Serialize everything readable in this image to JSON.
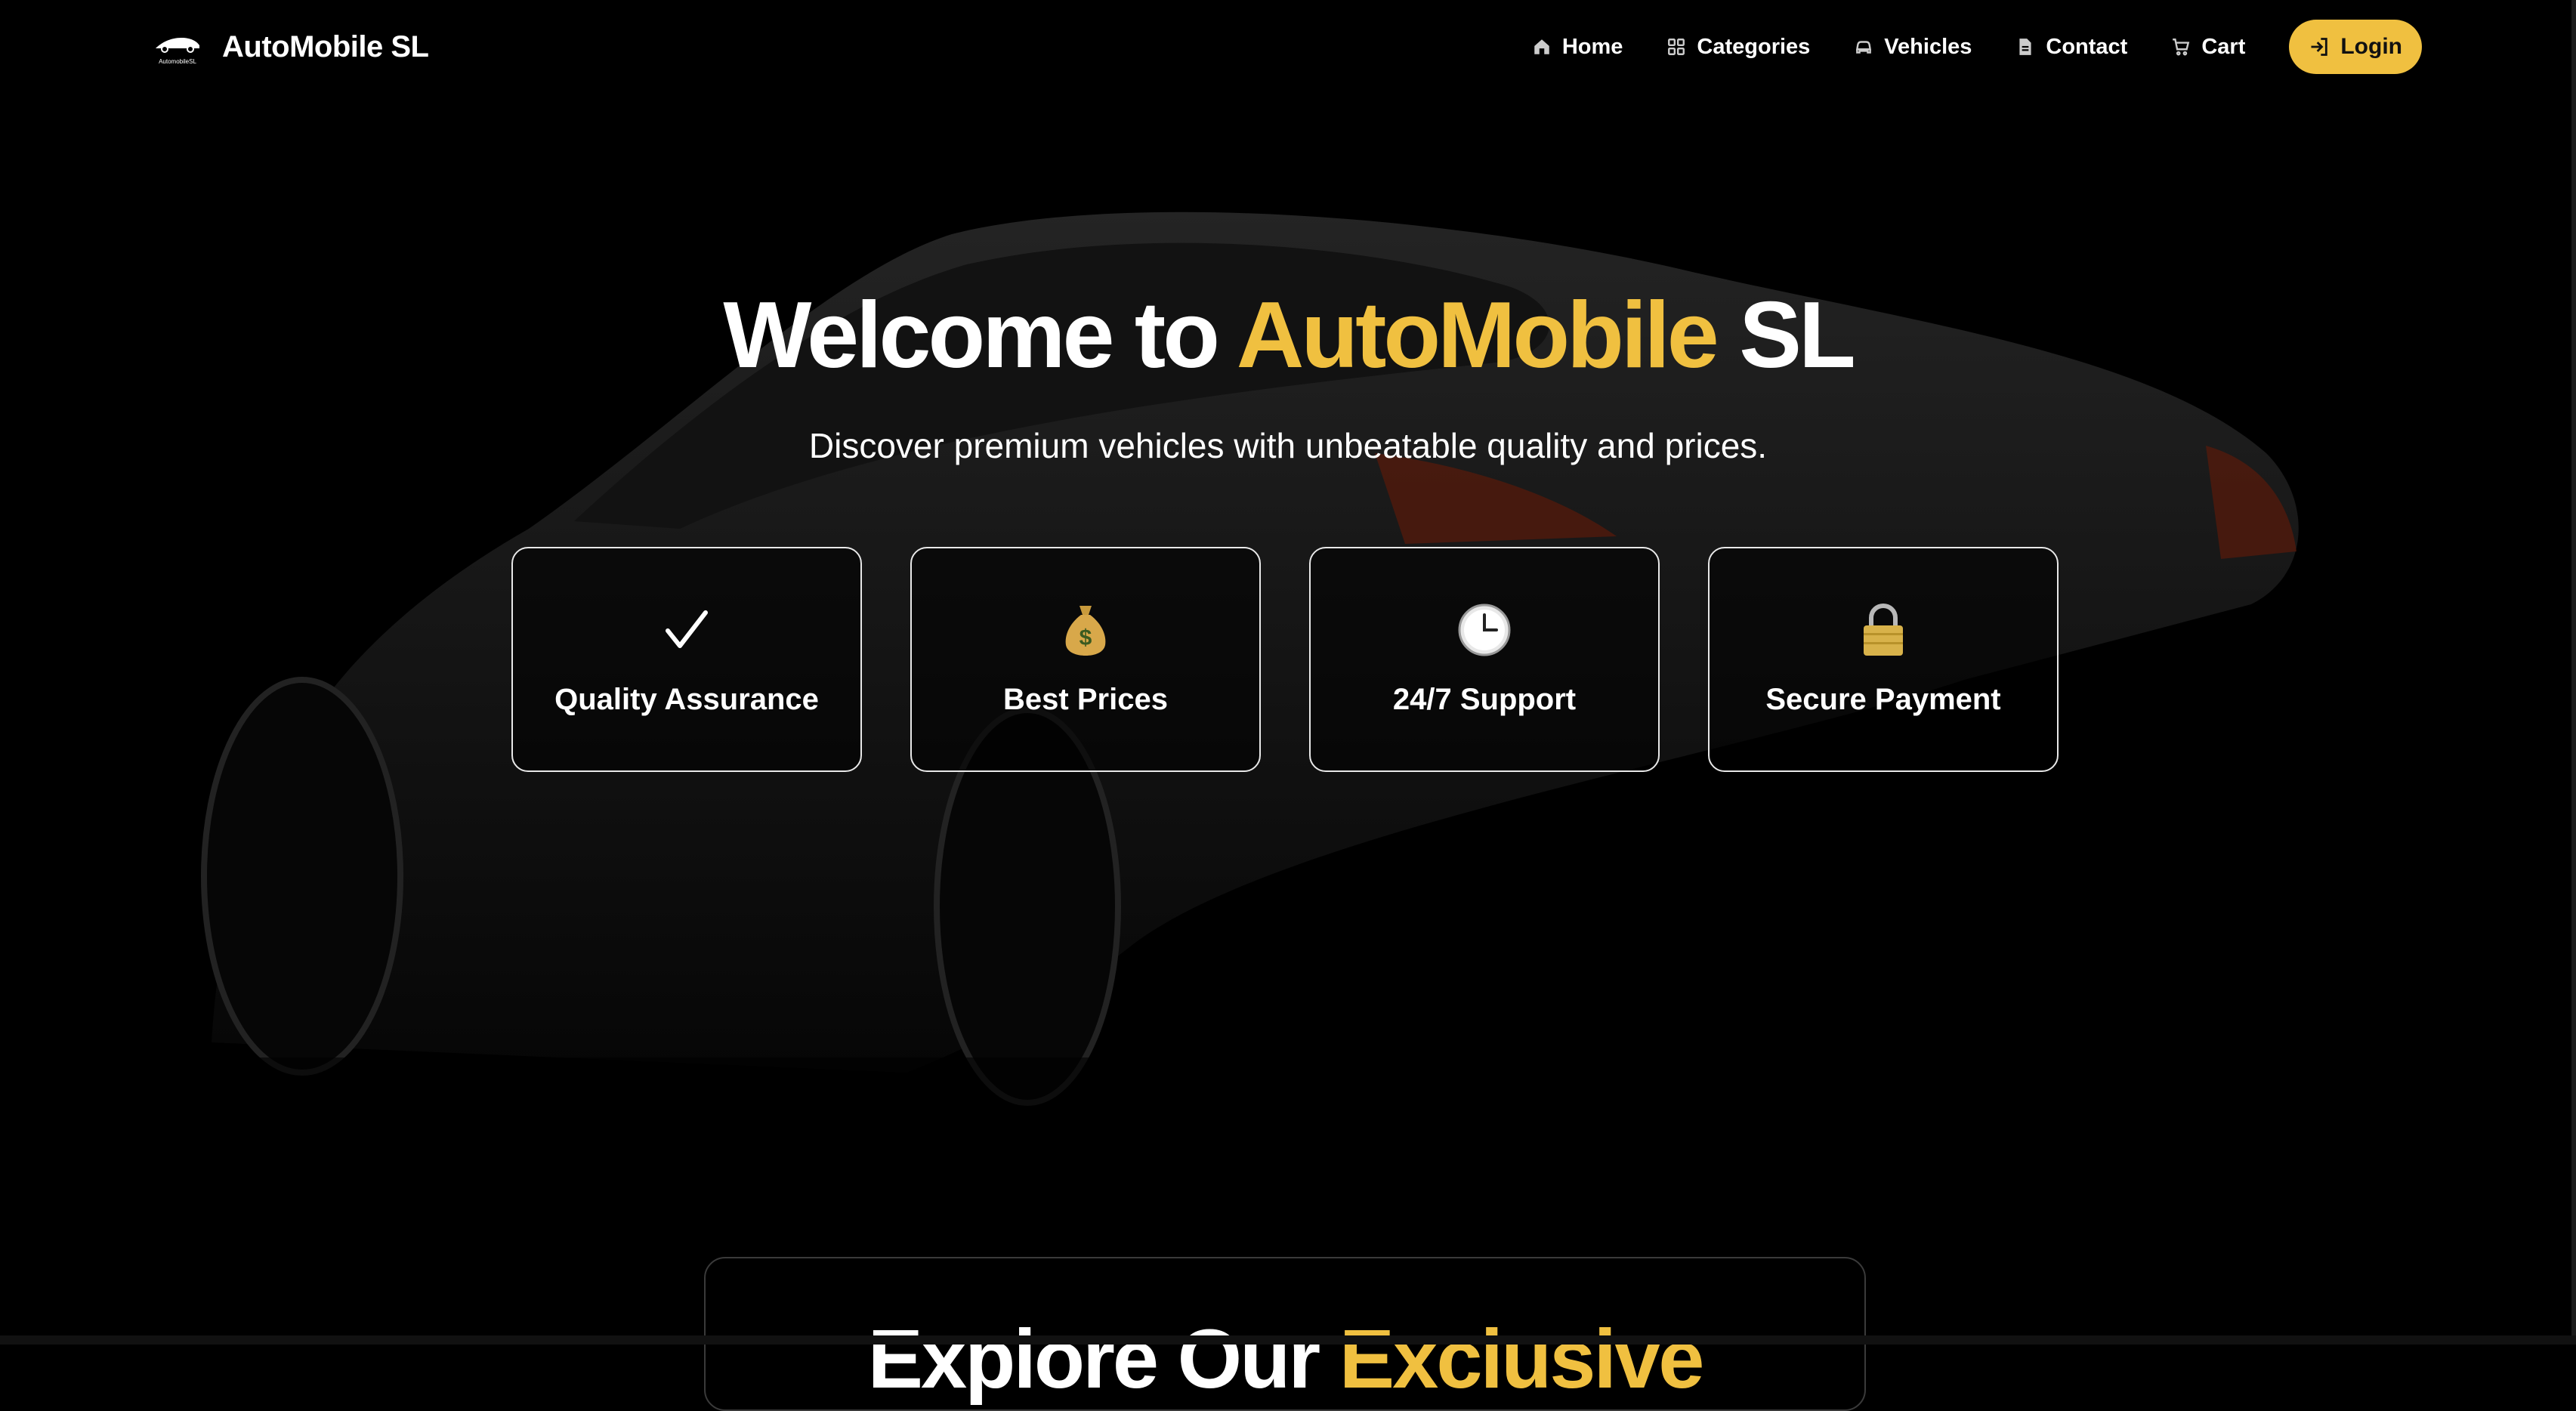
{
  "brand": {
    "name": "AutoMobile SL",
    "logo_text": "AutomobileSL",
    "logo_icon": "car-logo"
  },
  "nav": {
    "items": [
      {
        "label": "Home",
        "icon": "home-icon"
      },
      {
        "label": "Categories",
        "icon": "grid-icon"
      },
      {
        "label": "Vehicles",
        "icon": "car-icon"
      },
      {
        "label": "Contact",
        "icon": "document-icon"
      },
      {
        "label": "Cart",
        "icon": "cart-icon"
      }
    ],
    "login": {
      "label": "Login",
      "icon": "login-icon"
    }
  },
  "hero": {
    "title_prefix": "Welcome to",
    "title_accent": "AutoMobile",
    "title_suffix": "SL",
    "subtitle": "Discover premium vehicles with unbeatable quality and prices."
  },
  "features": [
    {
      "icon": "checkmark-icon",
      "glyph": "✓",
      "label": "Quality Assurance"
    },
    {
      "icon": "money-bag-icon",
      "glyph": "💰",
      "label": "Best Prices"
    },
    {
      "icon": "clock-icon",
      "glyph": "🕒",
      "label": "24/7 Support"
    },
    {
      "icon": "lock-icon",
      "glyph": "🔒",
      "label": "Secure Payment"
    }
  ],
  "section": {
    "title_prefix": "Explore Our",
    "title_accent": "Exclusive"
  },
  "colors": {
    "accent": "#f0c040",
    "background": "#000000",
    "text": "#ffffff"
  }
}
